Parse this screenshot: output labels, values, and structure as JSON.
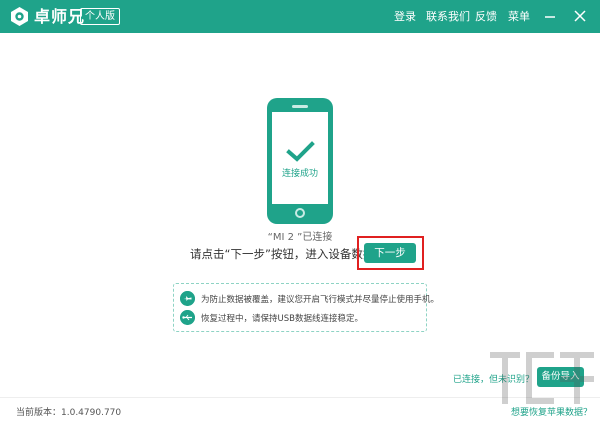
{
  "app": {
    "name": "卓师兄",
    "edition": "个人版"
  },
  "menu": {
    "login": "登录",
    "contact": "联系我们",
    "feedback": "反馈",
    "menu": "菜单"
  },
  "window_controls": {
    "minimize_icon": "minimize-icon",
    "close_icon": "close-icon"
  },
  "phone": {
    "screen_status": "连接成功"
  },
  "device": {
    "name_label": "“MI 2 ”已连接"
  },
  "instruction": {
    "text": "请点击“下一步”按钮，进入设备数据扫描"
  },
  "buttons": {
    "next": "下一步",
    "backup_import": "备份导入"
  },
  "tips": [
    {
      "icon": "airplane-icon",
      "text": "为防止数据被覆盖，建议您开启飞行模式并尽量停止使用手机。"
    },
    {
      "icon": "usb-icon",
      "text": "恢复过程中，请保持USB数据线连接稳定。"
    }
  ],
  "links": {
    "not_recognized": "已连接，但未识别？",
    "recover_apple": "想要恢复苹果数据？"
  },
  "footer": {
    "version": "当前版本：1.0.4790.770"
  },
  "colors": {
    "primary": "#1fa38a",
    "highlight": "#e02020"
  }
}
